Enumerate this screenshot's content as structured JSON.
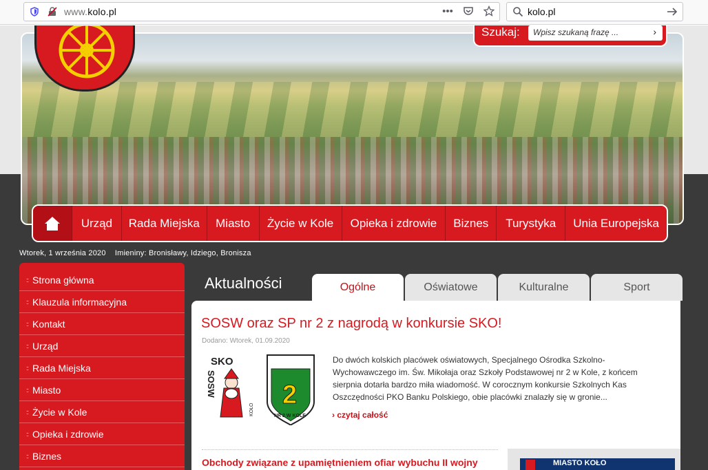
{
  "browser": {
    "url_prefix": "www.",
    "url_domain": "kolo.pl",
    "search_value": "kolo.pl"
  },
  "site_search": {
    "label": "Szukaj:",
    "placeholder": "Wpisz szukaną frazę ..."
  },
  "nav": {
    "items": [
      "Urząd",
      "Rada Miejska",
      "Miasto",
      "Życie w Kole",
      "Opieka i zdrowie",
      "Biznes",
      "Turystyka",
      "Unia Europejska"
    ]
  },
  "dateline": {
    "date": "Wtorek, 1 września 2020",
    "namedays": "Imieniny: Bronisławy, Idziego, Bronisza"
  },
  "sidebar": {
    "items": [
      "Strona główna",
      "Klauzula informacyjna",
      "Kontakt",
      "Urząd",
      "Rada Miejska",
      "Miasto",
      "Życie w Kole",
      "Opieka i zdrowie",
      "Biznes"
    ]
  },
  "news": {
    "title": "Aktualności",
    "tabs": [
      "Ogólne",
      "Oświatowe",
      "Kulturalne",
      "Sport"
    ],
    "active_tab": "Ogólne",
    "article": {
      "title": "SOSW oraz SP nr 2 z nagrodą w konkursie SKO!",
      "date": "Dodano: Wtorek, 01.09.2020",
      "text": "Do dwóch kolskich placówek oświatowych, Specjalnego Ośrodka Szkolno-Wychowawczego im. Św. Mikołaja oraz Szkoły Podstawowej nr 2 w Kole, z końcem sierpnia dotarła bardzo miła wiadomość. W corocznym konkursie Szkolnych Kas Oszczędności PKO Banku Polskiego, obie placówki  znalazły się w gronie...",
      "read_more": "czytaj całość",
      "thumb_labels": [
        "SKO",
        "SOSW",
        "KOŁO",
        "2",
        "NR 2 W KOLE"
      ]
    },
    "second_article_title": "Obchody związane z upamiętnieniem ofiar wybuchu II wojny",
    "side_banner": "MIASTO KOŁO"
  },
  "colors": {
    "brand_red": "#d71920",
    "dark_bg": "#3a3a3a"
  }
}
